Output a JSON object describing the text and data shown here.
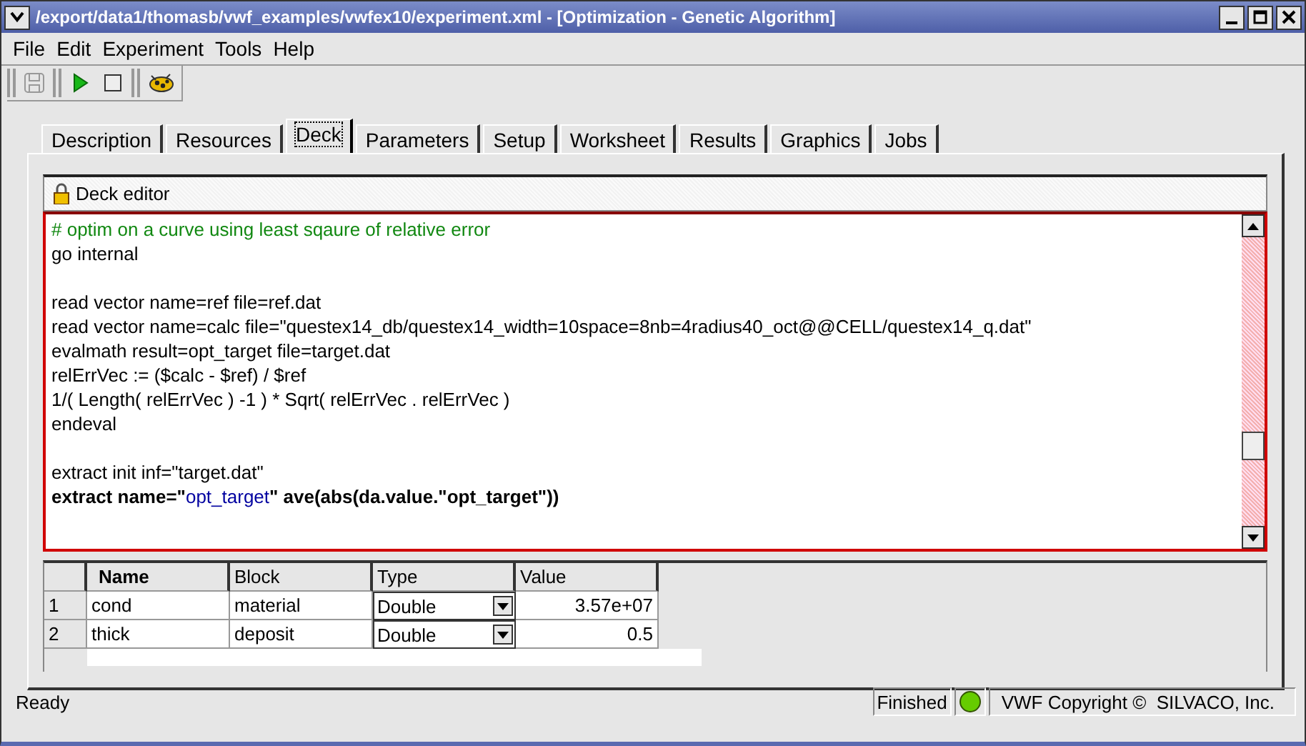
{
  "window": {
    "title": "/export/data1/thomasb/vwf_examples/vwfex10/experiment.xml - [Optimization - Genetic Algorithm]"
  },
  "menu": [
    "File",
    "Edit",
    "Experiment",
    "Tools",
    "Help"
  ],
  "toolbar": [
    {
      "kind": "grip"
    },
    {
      "kind": "save",
      "disabled": true
    },
    {
      "kind": "grip"
    },
    {
      "kind": "run",
      "disabled": false
    },
    {
      "kind": "stop",
      "disabled": false
    },
    {
      "kind": "grip"
    },
    {
      "kind": "bug",
      "disabled": false
    }
  ],
  "tabs": [
    {
      "label": "Description",
      "selected": false
    },
    {
      "label": "Resources",
      "selected": false
    },
    {
      "label": "Deck",
      "selected": true
    },
    {
      "label": "Parameters",
      "selected": false
    },
    {
      "label": "Setup",
      "selected": false
    },
    {
      "label": "Worksheet",
      "selected": false
    },
    {
      "label": "Results",
      "selected": false
    },
    {
      "label": "Graphics",
      "selected": false
    },
    {
      "label": "Jobs",
      "selected": false
    }
  ],
  "editor": {
    "title": "Deck editor",
    "lines": [
      {
        "kind": "comment",
        "text": "# optim on a curve using least sqaure of relative error"
      },
      {
        "kind": "code",
        "text": "go internal"
      },
      {
        "kind": "blank"
      },
      {
        "kind": "code",
        "text": "read vector name=ref file=ref.dat"
      },
      {
        "kind": "code",
        "text": "read vector name=calc file=\"questex14_db/questex14_width=10space=8nb=4radius40_oct@@CELL/questex14_q.dat\""
      },
      {
        "kind": "code",
        "text": "evalmath result=opt_target file=target.dat"
      },
      {
        "kind": "code",
        "text": "relErrVec := ($calc - $ref) / $ref"
      },
      {
        "kind": "code",
        "text": "1/( Length( relErrVec ) -1 ) * Sqrt( relErrVec . relErrVec )"
      },
      {
        "kind": "code",
        "text": "endeval"
      },
      {
        "kind": "blank"
      },
      {
        "kind": "code",
        "text": "extract init inf=\"target.dat\""
      },
      {
        "kind": "mixed",
        "segments": [
          {
            "kind": "bold",
            "text": "extract name=\""
          },
          {
            "kind": "string",
            "text": "opt_target"
          },
          {
            "kind": "bold",
            "text": "\" ave(abs(da.value.\"opt_target\"))"
          }
        ]
      }
    ]
  },
  "table": {
    "columns": [
      "Name",
      "Block",
      "Type",
      "Value"
    ],
    "rows": [
      {
        "number": "1",
        "name": "cond",
        "block": "material",
        "type": "Double",
        "value": "3.57e+07"
      },
      {
        "number": "2",
        "name": "thick",
        "block": "deposit",
        "type": "Double",
        "value": "0.5"
      }
    ]
  },
  "status_bar": {
    "message": "Ready",
    "state": "Finished",
    "copyright": "VWF Copyright ©  SILVACO, Inc."
  }
}
